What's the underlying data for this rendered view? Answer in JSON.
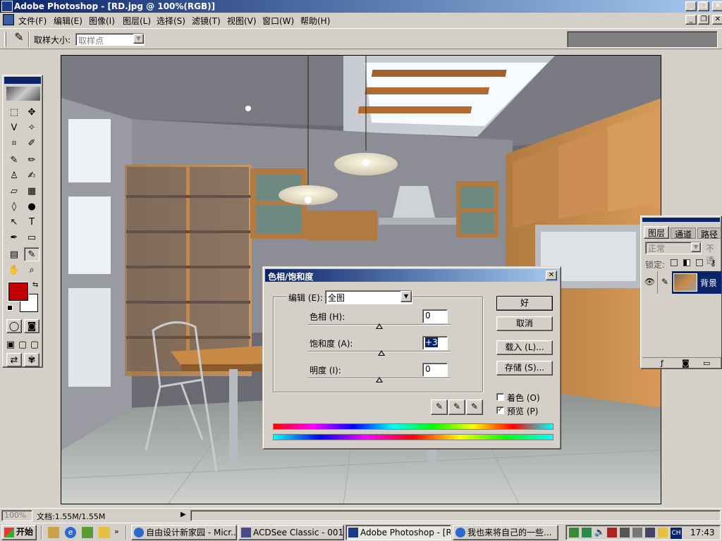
{
  "window": {
    "title": "Adobe Photoshop - [RD.jpg @ 100%(RGB)]"
  },
  "menu": [
    "文件(F)",
    "编辑(E)",
    "图像(I)",
    "图层(L)",
    "选择(S)",
    "滤镜(T)",
    "视图(V)",
    "窗口(W)",
    "帮助(H)"
  ],
  "options": {
    "sample_label": "取样大小:",
    "sample_value": "取样点"
  },
  "dialog": {
    "title": "色相/饱和度",
    "edit_label": "编辑 (E):",
    "edit_value": "全图",
    "hue_label": "色相 (H):",
    "hue_value": "0",
    "saturation_label": "饱和度 (A):",
    "saturation_value": "+3",
    "lightness_label": "明度 (I):",
    "lightness_value": "0",
    "ok": "好",
    "cancel": "取消",
    "load": "载入 (L)...",
    "save": "存储 (S)...",
    "colorize": "着色 (O)",
    "colorize_checked": false,
    "preview": "预览 (P)",
    "preview_checked": true,
    "slider_levels": {
      "hue": 0,
      "saturation": 3,
      "lightness": 0
    }
  },
  "layers_palette": {
    "tabs": [
      "图层",
      "通道",
      "路径"
    ],
    "blend_mode": "正常",
    "opacity_label": "不透",
    "lock_label": "锁定:",
    "layer_name": "背景"
  },
  "status": {
    "zoom": "100%",
    "doc": "文档:1.55M/1.55M"
  },
  "taskbar": {
    "start": "开始",
    "tasks": [
      "自由设计新家园 - Micr...",
      "ACDSee Classic - 001",
      "Adobe Photoshop - [RD...",
      "我也来将自己的一些..."
    ],
    "ime": "CH",
    "clock": "17:43"
  },
  "colors": {
    "title_bar_start": "#0a246a",
    "title_bar_end": "#a6caf0",
    "foreground_swatch": "#c00000",
    "background_swatch": "#ffffff",
    "face": "#d4d0c8"
  }
}
